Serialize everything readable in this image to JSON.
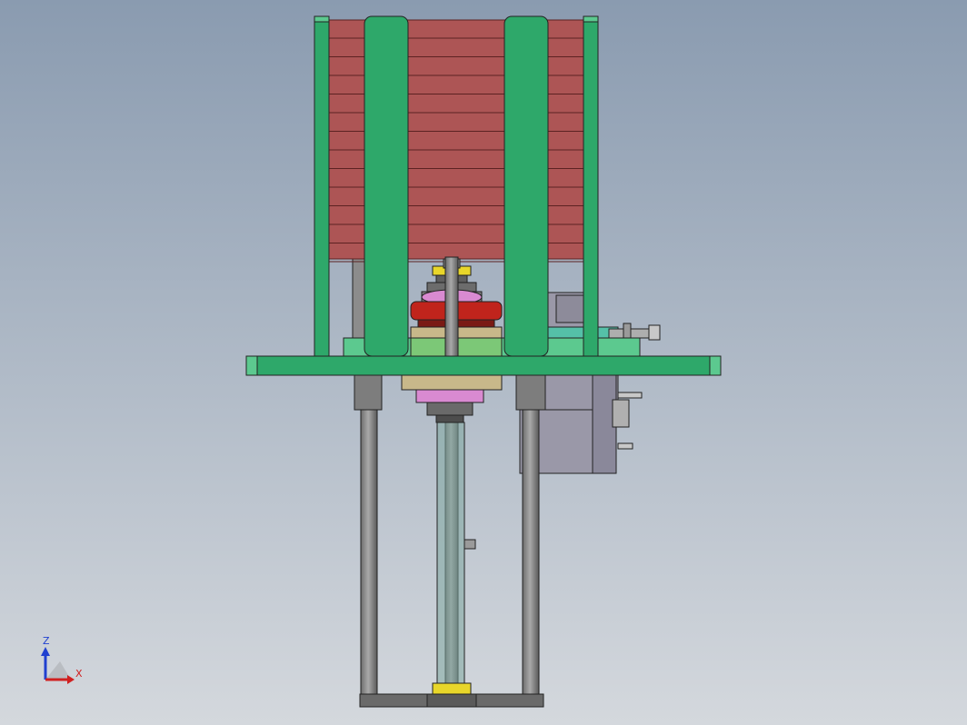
{
  "viewport": {
    "background_top": "#8a9bb0",
    "background_bottom": "#d4d8dd"
  },
  "colors": {
    "frame_green": "#2ea86a",
    "frame_green_light": "#5cc98f",
    "stack_red": "#ad5555",
    "stack_line": "#5c2222",
    "steel_gray": "#8c8c8c",
    "steel_dark": "#5f5f5f",
    "motor_gray": "#9a98a8",
    "tan": "#c8b88a",
    "pink": "#d98ad1",
    "yellow": "#e8d62a",
    "disc_red": "#c0241c",
    "outline": "#222222",
    "axis_z": "#2040d0",
    "axis_x": "#d02020"
  },
  "triad": {
    "z_label": "Z",
    "x_label": "X"
  }
}
